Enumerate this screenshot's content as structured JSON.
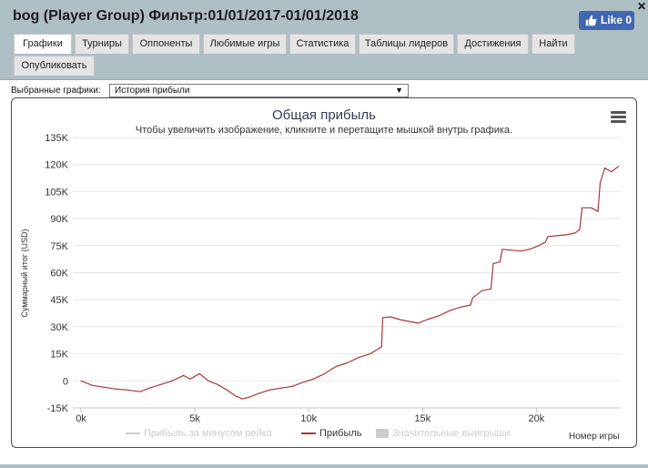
{
  "window": {
    "title": "bog (Player Group) Фильтр:01/01/2017-01/01/2018",
    "close_icon": "close-icon",
    "like_label": "Like 0"
  },
  "tabs": [
    {
      "label": "Графики",
      "active": true
    },
    {
      "label": "Турниры",
      "active": false
    },
    {
      "label": "Оппоненты",
      "active": false
    },
    {
      "label": "Любимые игры",
      "active": false
    },
    {
      "label": "Статистика",
      "active": false
    },
    {
      "label": "Таблицы лидеров",
      "active": false
    },
    {
      "label": "Достижения",
      "active": false
    },
    {
      "label": "Найти",
      "active": false
    },
    {
      "label": "Опубликовать",
      "active": false
    }
  ],
  "selector": {
    "label": "Выбранные графики:",
    "value": "История прибыли"
  },
  "chart_data": {
    "type": "line",
    "title": "Общая прибыль",
    "subtitle": "Чтобы увеличить изображение, кликните и перетащите мышкой внутрь графика.",
    "ylabel": "Суммарный итог (USD)",
    "xlabel": "Номер игры",
    "ylim": [
      -15000,
      135000
    ],
    "xlim": [
      0,
      23700
    ],
    "y_ticks": [
      -15000,
      0,
      15000,
      30000,
      45000,
      60000,
      75000,
      90000,
      105000,
      120000,
      135000
    ],
    "y_tick_labels": [
      "-15K",
      "0",
      "15K",
      "30K",
      "45K",
      "60K",
      "75K",
      "90K",
      "105K",
      "120K",
      "135K"
    ],
    "x_ticks": [
      0,
      5000,
      10000,
      15000,
      20000
    ],
    "x_tick_labels": [
      "0k",
      "5k",
      "10k",
      "15k",
      "20k"
    ],
    "grid": true,
    "legend_position": "bottom",
    "series": [
      {
        "name": "Прибыль за минусом рейка",
        "color": "#cccccc",
        "visible": false,
        "values": []
      },
      {
        "name": "Прибыль",
        "color": "#a8383b",
        "visible": true,
        "x": [
          0,
          500,
          1000,
          1500,
          2000,
          2600,
          3000,
          3500,
          4000,
          4500,
          4800,
          5200,
          5600,
          6000,
          6400,
          6800,
          7100,
          7400,
          7800,
          8300,
          8800,
          9300,
          9700,
          10200,
          10700,
          11200,
          11700,
          12200,
          12700,
          13200,
          13250,
          13600,
          14000,
          14400,
          14800,
          15200,
          15700,
          16200,
          16700,
          17100,
          17200,
          17600,
          18000,
          18100,
          18400,
          18500,
          18900,
          19300,
          19700,
          20100,
          20400,
          20500,
          20900,
          21300,
          21700,
          21900,
          22000,
          22400,
          22700,
          22800,
          23000,
          23300,
          23600
        ],
        "y": [
          0,
          -2500,
          -3500,
          -4500,
          -5000,
          -6000,
          -4000,
          -2000,
          0,
          3000,
          1000,
          4000,
          0,
          -2000,
          -5000,
          -8500,
          -10000,
          -9000,
          -7000,
          -5000,
          -4000,
          -3000,
          -1000,
          1000,
          4000,
          8000,
          10000,
          13000,
          15000,
          19000,
          35000,
          35500,
          34000,
          33000,
          32000,
          34000,
          36000,
          39000,
          41000,
          42000,
          46000,
          50000,
          51000,
          65000,
          66000,
          73000,
          72500,
          72000,
          73000,
          75000,
          77000,
          80000,
          80500,
          81000,
          82000,
          84000,
          96000,
          96000,
          94000,
          110000,
          118000,
          116000,
          119000
        ]
      },
      {
        "name": "Значительные выигрыши",
        "color": "#cccccc",
        "visible": false,
        "values": []
      }
    ]
  },
  "menu_icon": "hamburger-menu-icon"
}
